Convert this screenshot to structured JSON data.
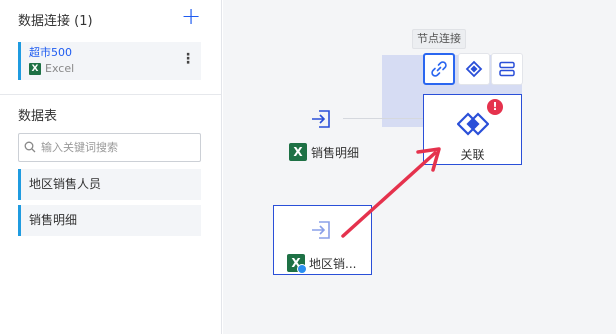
{
  "sidebar": {
    "connections_title": "数据连接 (1)",
    "add_label": "+",
    "connection": {
      "name": "超市500",
      "type": "Excel",
      "icon": "excel-icon"
    },
    "tables_title": "数据表",
    "search": {
      "placeholder": "输入关键词搜索",
      "value": ""
    },
    "tables": [
      {
        "label": "地区销售人员"
      },
      {
        "label": "销售明细"
      }
    ]
  },
  "canvas": {
    "tooltip": "节点连接",
    "toolbar": [
      {
        "icon": "link-icon",
        "active": true
      },
      {
        "icon": "join-icon",
        "active": false
      },
      {
        "icon": "stack-icon",
        "active": false
      }
    ],
    "nodes": [
      {
        "id": "sales-detail",
        "label": "销售明细",
        "icon": "input-arrow-icon"
      },
      {
        "id": "join",
        "label": "关联",
        "icon": "join-diamond-icon",
        "badge": "!"
      },
      {
        "id": "region-sales",
        "label": "地区销...",
        "icon": "input-arrow-icon"
      }
    ]
  },
  "colors": {
    "accent": "#1f5cf0",
    "node_border": "#2a4fd8",
    "error": "#e5324d",
    "excel": "#1e7145",
    "arrow": "#e5324d"
  }
}
